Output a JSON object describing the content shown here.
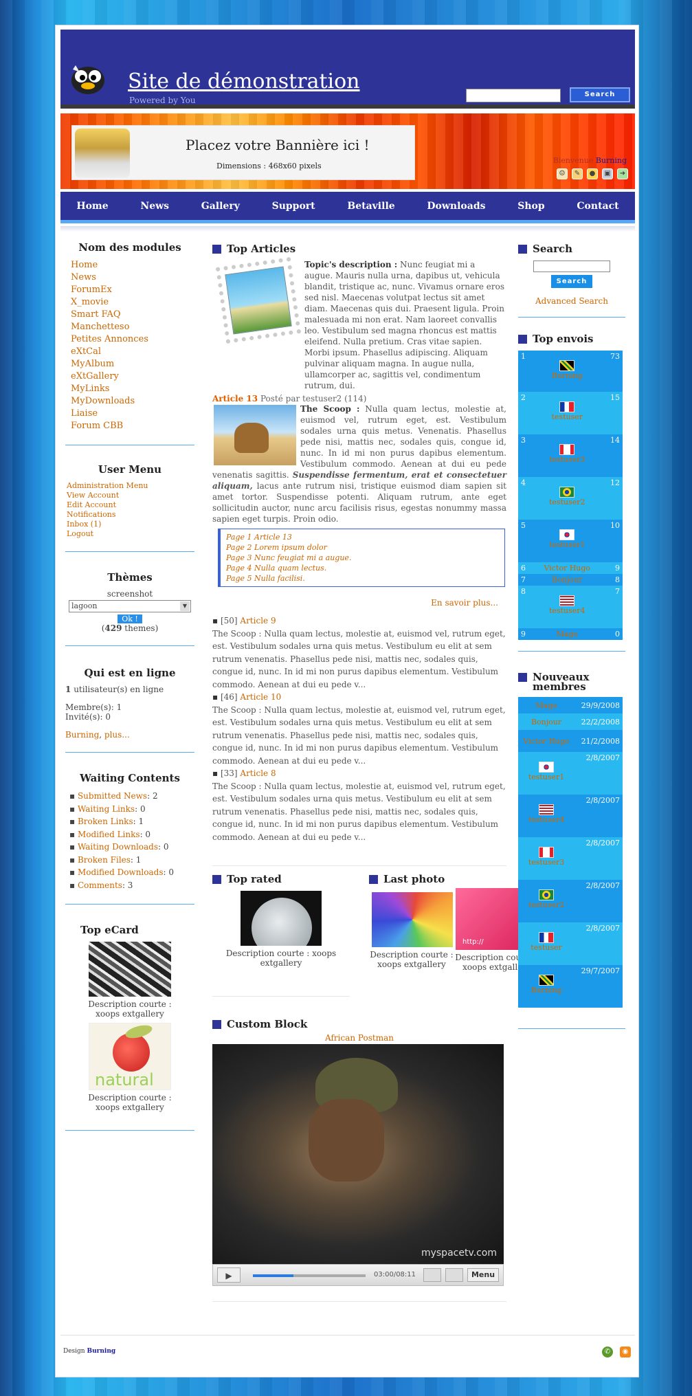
{
  "header": {
    "title": "Site de démonstration",
    "subtitle": "Powered by You",
    "search_button": "Search"
  },
  "banner": {
    "title": "Placez votre Bannière ici !",
    "size": "Dimensions : 468x60 pixels",
    "welcome": "Bienvenue",
    "user": "Burning"
  },
  "nav": [
    "Home",
    "News",
    "Gallery",
    "Support",
    "Betaville",
    "Downloads",
    "Shop",
    "Contact"
  ],
  "modules": {
    "title": "Nom des modules",
    "items": [
      "Home",
      "News",
      "ForumEx",
      "X_movie",
      "Smart FAQ",
      "Manchetteso",
      "Petites Annonces",
      "eXtCal",
      "MyAlbum",
      "eXtGallery",
      "MyLinks",
      "MyDownloads",
      "Liaise",
      "Forum CBB"
    ]
  },
  "usermenu": {
    "title": "User Menu",
    "items": [
      "Administration Menu",
      "View Account",
      "Edit Account",
      "Notifications",
      "Inbox (1)",
      "Logout"
    ]
  },
  "themes": {
    "title": "Thèmes",
    "label": "screenshot",
    "selected": "lagoon",
    "button": "Ok !",
    "count": "429",
    "count_suffix": "themes)"
  },
  "online": {
    "title": "Qui est en ligne",
    "line1": "utilisateur(s) en ligne",
    "count": "1",
    "members": "Membre(s): 1",
    "guests": "Invité(s): 0",
    "user": "Burning",
    "more": "plus..."
  },
  "waiting": {
    "title": "Waiting Contents",
    "items": [
      [
        "Submitted News",
        "2"
      ],
      [
        "Waiting Links",
        "0"
      ],
      [
        "Broken Links",
        "1"
      ],
      [
        "Modified Links",
        "0"
      ],
      [
        "Waiting Downloads",
        "0"
      ],
      [
        "Broken Files",
        "1"
      ],
      [
        "Modified Downloads",
        "0"
      ],
      [
        "Comments",
        "3"
      ]
    ]
  },
  "ecard": {
    "title": "Top eCard",
    "desc1": "Description courte : xoops extgallery",
    "desc2": "Description courte : xoops extgallery",
    "natural": "natural"
  },
  "articles": {
    "title": "Top Articles",
    "topic_label": "Topic's description :",
    "topic_text": "Nunc feugiat mi a augue. Mauris nulla urna, dapibus ut, vehicula blandit, tristique ac, nunc. Vivamus ornare eros sed nisl. Maecenas volutpat lectus sit amet diam. Maecenas quis dui. Praesent ligula. Proin malesuada mi non erat. Nam laoreet convallis leo. Vestibulum sed magna rhoncus est mattis eleifend. Nulla pretium. Cras vitae sapien. Morbi ipsum. Phasellus adipiscing. Aliquam pulvinar aliquam magna. In augue nulla, ullamcorper ac, sagittis vel, condimentum rutrum, dui.",
    "article_title": "Article 13",
    "posted": "Posté par testuser2 (114)",
    "scoop_label": "The Scoop :",
    "scoop_text": "Nulla quam lectus, molestie at, euismod vel, rutrum eget, est. Vestibulum sodales urna quis metus. Venenatis. Phasellus pede nisi, mattis nec, sodales quis, congue id, nunc. In id mi non purus dapibus elementum. Vestibulum commodo. Aenean at dui eu pede venenatis sagittis.",
    "scoop_bold": "Suspendisse fermentum, erat et consectetuer aliquam,",
    "scoop_text2": "lacus ante rutrum nisi, tristique euismod diam sapien sit amet tortor. Suspendisse potenti. Aliquam rutrum, ante eget sollicitudin auctor, nunc arcu facilisis risus, egestas nonummy massa sapien eget turpis. Proin odio.",
    "pages": [
      "Page 1 Article 13",
      "Page 2 Lorem ipsum dolor",
      "Page 3 Nunc feugiat mi a augue.",
      "Page 4 Nulla quam lectus.",
      "Page 5 Nulla facilisi."
    ],
    "more": "En savoir plus...",
    "list": [
      {
        "num": "[50]",
        "title": "Article 9"
      },
      {
        "num": "[46]",
        "title": "Article 10"
      },
      {
        "num": "[33]",
        "title": "Article 8"
      }
    ],
    "list_text": "The Scoop : Nulla quam lectus, molestie at, euismod vel, rutrum eget, est. Vestibulum sodales urna quis metus. Vestibulum eu elit at sem rutrum venenatis. Phasellus pede nisi, mattis nec, sodales quis, congue id, nunc. In id mi non purus dapibus elementum. Vestibulum commodo. Aenean at dui eu pede v..."
  },
  "toprated": {
    "title": "Top rated",
    "desc": "Description courte : xoops extgallery"
  },
  "lastphoto": {
    "title": "Last photo",
    "desc1": "Description courte : xoops extgallery",
    "desc2": "Description courte : xoops extgallery",
    "url": "http://"
  },
  "custom": {
    "title": "Custom Block",
    "link": "African Postman",
    "time": "03:00/08:11",
    "menu": "Menu",
    "watermark": "myspacetv.com"
  },
  "search": {
    "title": "Search",
    "button": "Search",
    "advanced": "Advanced Search"
  },
  "topposters": {
    "title": "Top envois",
    "rows": [
      [
        "1",
        "73",
        "Burning",
        "jm"
      ],
      [
        "2",
        "15",
        "testuser",
        "fr"
      ],
      [
        "3",
        "14",
        "testuser3",
        "ca"
      ],
      [
        "4",
        "12",
        "testuser2",
        "br"
      ],
      [
        "5",
        "10",
        "testuser1",
        "kr"
      ],
      [
        "6",
        "9",
        "Victor Hugo",
        ""
      ],
      [
        "7",
        "8",
        "Bonjour",
        ""
      ],
      [
        "8",
        "7",
        "testuser4",
        "us"
      ],
      [
        "9",
        "0",
        "Mage",
        ""
      ]
    ]
  },
  "newmembers": {
    "title": "Nouveaux membres",
    "rows": [
      [
        "Mage",
        "29/9/2008",
        ""
      ],
      [
        "Bonjour",
        "22/2/2008",
        ""
      ],
      [
        "Victor Hugo",
        "21/2/2008",
        ""
      ],
      [
        "testuser1",
        "2/8/2007",
        "kr"
      ],
      [
        "testuser4",
        "2/8/2007",
        "us"
      ],
      [
        "testuser3",
        "2/8/2007",
        "ca"
      ],
      [
        "testuser2",
        "2/8/2007",
        "br"
      ],
      [
        "testuser",
        "2/8/2007",
        "fr"
      ],
      [
        "Burning",
        "29/7/2007",
        "jm"
      ]
    ]
  },
  "footer": {
    "label": "Design",
    "user": "Burning"
  }
}
